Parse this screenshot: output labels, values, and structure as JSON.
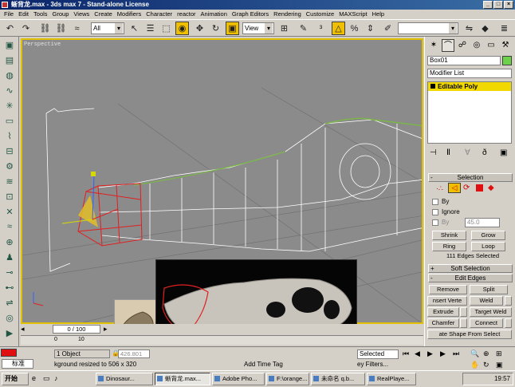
{
  "window": {
    "title": "蜥背龙.max - 3ds max 7 - Stand-alone License"
  },
  "menu": [
    "File",
    "Edit",
    "Tools",
    "Group",
    "Views",
    "Create",
    "Modifiers",
    "Character",
    "reactor",
    "Animation",
    "Graph Editors",
    "Rendering",
    "Customize",
    "MAXScript",
    "Help"
  ],
  "toolbar": {
    "selection_filter": "All",
    "reference_coord": "View"
  },
  "viewport": {
    "label": "Perspective"
  },
  "right_panel": {
    "object_name": "Box01",
    "modifier_list": "Modifier List",
    "stack_item": "Editable Poly",
    "selection_rollout": "Selection",
    "by_label": "By",
    "ignore_label": "Ignore",
    "by_angle_label": "By",
    "angle_value": "45.0",
    "shrink": "Shrink",
    "grow": "Grow",
    "ring": "Ring",
    "loop": "Loop",
    "edges_selected": "111 Edges Selected",
    "soft_selection": "Soft Selection",
    "edit_edges": "Edit Edges",
    "remove": "Remove",
    "split": "Split",
    "insert_vertex": "nsert Verte",
    "weld": "Weld",
    "extrude": "Extrude",
    "target_weld": "Target Weld",
    "chamfer": "Chamfer",
    "connect": "Connect",
    "create_shape": "ate Shape From Select"
  },
  "timeline": {
    "frame": "0 / 100",
    "ticks": [
      "0",
      "10"
    ]
  },
  "status": {
    "prompt_left": "标准",
    "objects": "1 Object",
    "message": "kground resized to 506 x 320",
    "coord_y": "426.801",
    "add_time_tag": "Add Time Tag",
    "selected": "Selected",
    "filters": "ey Filters..."
  },
  "taskbar": {
    "start": "开始",
    "tasks": [
      "Dinosaur...",
      "蜥背龙.max...",
      "Adobe Pho...",
      "F:\\orange...",
      "未命名 q.b...",
      "RealPlaye..."
    ],
    "clock": "19:57"
  }
}
